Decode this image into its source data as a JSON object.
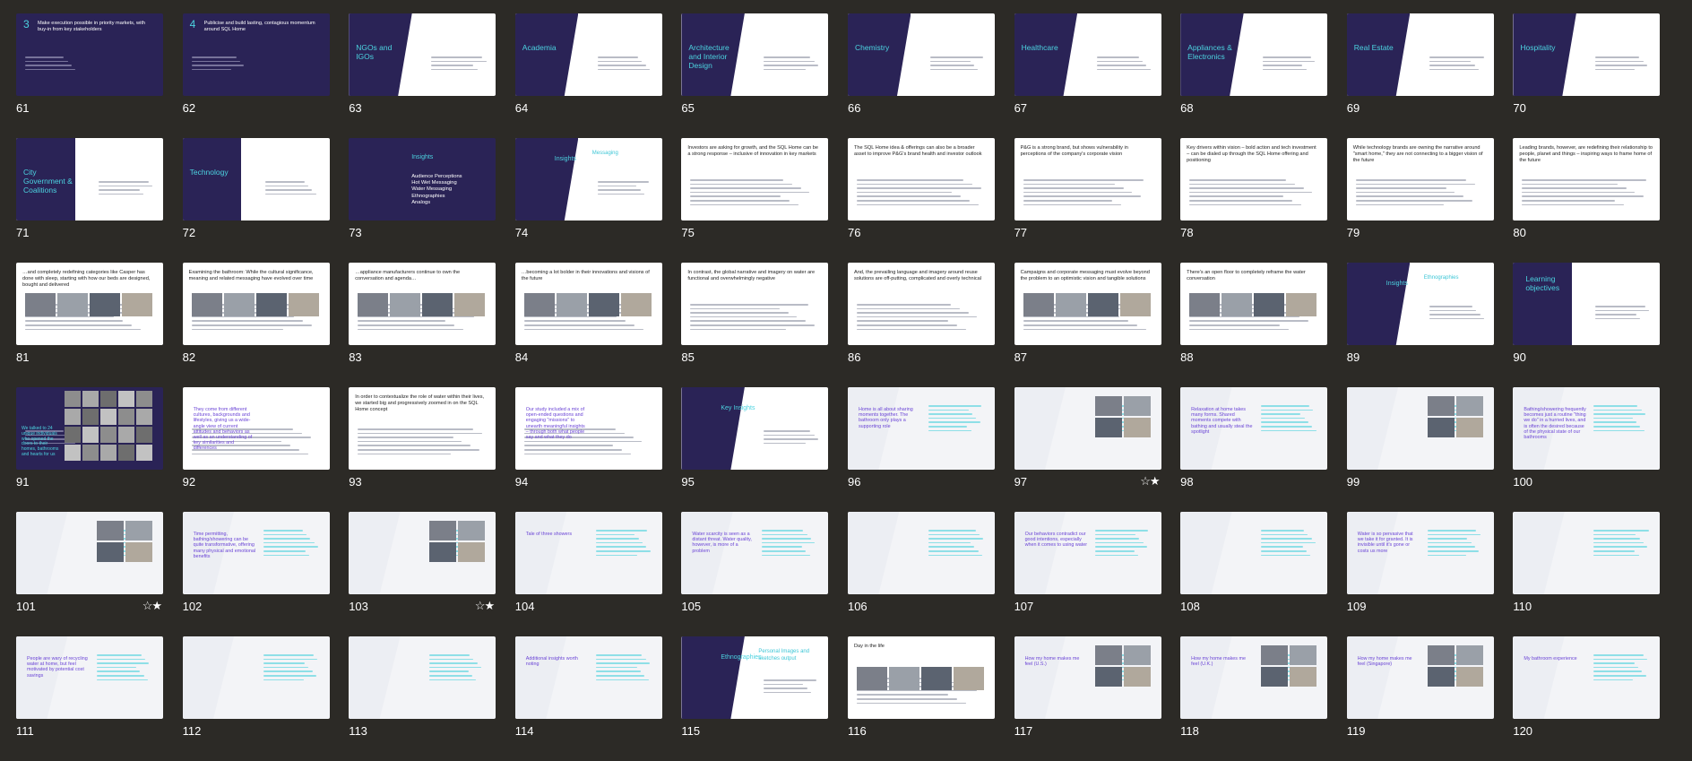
{
  "slides": [
    {
      "number": "61",
      "style": "dark",
      "title": "Make execution possible in priority markets, with buy-in from key stakeholders",
      "big": "3"
    },
    {
      "number": "62",
      "style": "dark",
      "title": "Publicise and build lasting, contagious momentum around SQL Home",
      "big": "4"
    },
    {
      "number": "63",
      "style": "split",
      "big": "NGOs and IGOs"
    },
    {
      "number": "64",
      "style": "split",
      "big": "Academia"
    },
    {
      "number": "65",
      "style": "split",
      "big": "Architecture and Interior Design"
    },
    {
      "number": "66",
      "style": "split",
      "big": "Chemistry"
    },
    {
      "number": "67",
      "style": "split",
      "big": "Healthcare"
    },
    {
      "number": "68",
      "style": "split",
      "big": "Appliances & Electronics"
    },
    {
      "number": "69",
      "style": "split",
      "big": "Real Estate"
    },
    {
      "number": "70",
      "style": "split",
      "big": "Hospitality"
    },
    {
      "number": "71",
      "style": "panel",
      "big": "City Government & Coalitions"
    },
    {
      "number": "72",
      "style": "panel",
      "big": "Technology"
    },
    {
      "number": "73",
      "style": "dark",
      "big": "Insights",
      "title": "Audience Perceptions\nHot Wet Messaging\nWater Messaging\nEthnographies\nAnalogs"
    },
    {
      "number": "74",
      "style": "split",
      "big": "Insights",
      "title": "Messaging"
    },
    {
      "number": "75",
      "style": "white",
      "title": "Investors are asking for growth, and the SQL Home can be a strong response – inclusive of innovation in key markets"
    },
    {
      "number": "76",
      "style": "white",
      "title": "The SQL Home idea & offerings can also be a broader asset to improve P&G's brand health and investor outlook"
    },
    {
      "number": "77",
      "style": "white",
      "title": "P&G is a strong brand, but shows vulnerability in perceptions of the company's corporate vision"
    },
    {
      "number": "78",
      "style": "white",
      "title": "Key drivers within vision – bold action and tech investment – can be dialed up through the SQL Home offering and positioning"
    },
    {
      "number": "79",
      "style": "white",
      "title": "While technology brands are owning the narrative around \"smart home,\" they are not connecting to a bigger vision of the future"
    },
    {
      "number": "80",
      "style": "white",
      "title": "Leading brands, however, are redefining their relationship to people, planet and things – inspiring ways to frame home of the future"
    },
    {
      "number": "81",
      "style": "white",
      "title": "…and completely redefining categories like Casper has done with sleep, starting with how our beds are designed, bought and delivered"
    },
    {
      "number": "82",
      "style": "white",
      "title": "Examining the bathroom: While the cultural significance, meaning and related messaging have evolved over time"
    },
    {
      "number": "83",
      "style": "white",
      "title": "…appliance manufacturers continue to own the conversation and agenda…"
    },
    {
      "number": "84",
      "style": "white",
      "title": "…becoming a lot bolder in their innovations and visions of the future"
    },
    {
      "number": "85",
      "style": "white",
      "title": "In contrast, the global narrative and imagery on water are functional and overwhelmingly negative"
    },
    {
      "number": "86",
      "style": "white",
      "title": "And, the prevailing language and imagery around reuse solutions are off-putting, complicated and overly technical"
    },
    {
      "number": "87",
      "style": "white",
      "title": "Campaigns and corporate messaging must evolve beyond the problem to an optimistic vision and tangible solutions"
    },
    {
      "number": "88",
      "style": "white",
      "title": "There's an open floor to completely reframe the water conversation"
    },
    {
      "number": "89",
      "style": "split",
      "big": "Insights",
      "title": "Ethnographies"
    },
    {
      "number": "90",
      "style": "panel",
      "big": "Learning objectives"
    },
    {
      "number": "91",
      "style": "dark",
      "big": "We talked to 24 unique individuals who opened the doors to their homes, bathrooms and hearts for us"
    },
    {
      "number": "92",
      "style": "white",
      "big": "They come from different cultures, backgrounds and lifestyles, giving us a wide-angle view of current attitudes and behaviors as well as an understanding of key similarities and differences"
    },
    {
      "number": "93",
      "style": "white",
      "title": "In order to contextualize the role of water within their lives, we started big and progressively zoomed in on the SQL Home concept"
    },
    {
      "number": "94",
      "style": "white",
      "big": "Our study included a mix of open-ended questions and engaging \"missions\" to unearth meaningful insights – through both what people say and what they do"
    },
    {
      "number": "95",
      "style": "split",
      "big": "Key Insights"
    },
    {
      "number": "96",
      "style": "light",
      "big": "Home is all about sharing moments together. The bathroom only plays a supporting role"
    },
    {
      "number": "97",
      "style": "light",
      "star": "☆★"
    },
    {
      "number": "98",
      "style": "light",
      "big": "Relaxation at home takes many forms. Shared moments compete with bathing and usually steal the spotlight"
    },
    {
      "number": "99",
      "style": "light"
    },
    {
      "number": "100",
      "style": "light",
      "big": "Bathing/showering frequently becomes just a routine \"thing we do\" in a hurried lives, and is often the desired because of the physical state of our bathrooms"
    },
    {
      "number": "101",
      "style": "light",
      "star": "☆★"
    },
    {
      "number": "102",
      "style": "light",
      "big": "Time permitting, bathing/showering can be quite transformative, offering many physical and emotional benefits"
    },
    {
      "number": "103",
      "style": "light",
      "star": "☆★"
    },
    {
      "number": "104",
      "style": "light",
      "big": "Tale of three showers"
    },
    {
      "number": "105",
      "style": "light",
      "big": "Water scarcity is seen as a distant threat. Water quality, however, is more of a problem"
    },
    {
      "number": "106",
      "style": "light"
    },
    {
      "number": "107",
      "style": "light",
      "big": "Our behaviors contradict our good intentions, especially when it comes to using water"
    },
    {
      "number": "108",
      "style": "light"
    },
    {
      "number": "109",
      "style": "light",
      "big": "Water is so pervasive that we take it for granted. It is invisible until it's gone or costs us more"
    },
    {
      "number": "110",
      "style": "light"
    },
    {
      "number": "111",
      "style": "light",
      "big": "People are wary of recycling water at home, but feel motivated by potential cost savings"
    },
    {
      "number": "112",
      "style": "light"
    },
    {
      "number": "113",
      "style": "light"
    },
    {
      "number": "114",
      "style": "light",
      "big": "Additional insights worth noting"
    },
    {
      "number": "115",
      "style": "split",
      "big": "Ethnographies",
      "title": "Personal Images and sketches output"
    },
    {
      "number": "116",
      "style": "white",
      "title": "Day in the life"
    },
    {
      "number": "117",
      "style": "light",
      "big": "How my home makes me feel (U.S.)"
    },
    {
      "number": "118",
      "style": "light",
      "big": "How my home makes me feel (U.K.)"
    },
    {
      "number": "119",
      "style": "light",
      "big": "How my home makes me feel (Singapore)"
    },
    {
      "number": "120",
      "style": "light",
      "big": "My bathroom experience"
    }
  ],
  "colors": {
    "background": "#2c2a26",
    "navy": "#2a2356",
    "cyan": "#3ec6d6",
    "purple": "#6b45d6"
  }
}
